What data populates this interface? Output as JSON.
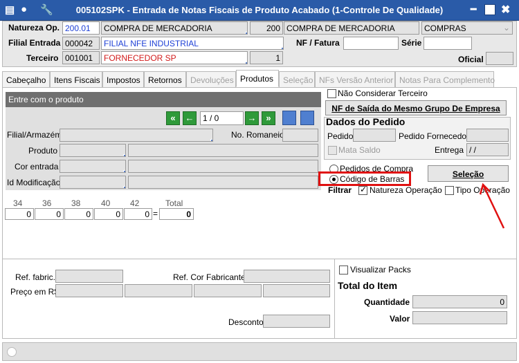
{
  "window": {
    "title": "005102SPK - Entrada de Notas Fiscais de Produto Acabado (1-Controle De Qualidade)"
  },
  "header": {
    "natureza_label": "Natureza Op.",
    "natureza_code": "200.01",
    "natureza_desc": "COMPRA DE MERCADORIA",
    "natureza_num": "200",
    "natureza_desc2": "COMPRA DE MERCADORIA",
    "natureza_type": "COMPRAS",
    "filial_label": "Filial Entrada",
    "filial_code": "000042",
    "filial_desc": "FILIAL NFE INDUSTRIAL",
    "terceiro_label": "Terceiro",
    "terceiro_code": "001001",
    "terceiro_desc": "FORNECEDOR SP",
    "terceiro_num": "1",
    "nf_fatura_label": "NF / Fatura",
    "serie_label": "Série",
    "oficial_label": "Oficial"
  },
  "tabs": [
    {
      "label": "Cabeçalho",
      "state": "normal"
    },
    {
      "label": "Itens Fiscais",
      "state": "normal"
    },
    {
      "label": "Impostos",
      "state": "normal"
    },
    {
      "label": "Retornos",
      "state": "normal"
    },
    {
      "label": "Devoluções",
      "state": "disabled"
    },
    {
      "label": "Produtos",
      "state": "active"
    },
    {
      "label": "Seleção",
      "state": "disabled"
    },
    {
      "label": "NFs Versão Anterior",
      "state": "disabled"
    },
    {
      "label": "Notas Para Complemento",
      "state": "disabled"
    }
  ],
  "produto_panel": {
    "title": "Entre com o produto",
    "counter": "1 / 0",
    "filial_label": "Filial/Armazém",
    "romaneio_label": "No. Romaneio",
    "produto_label": "Produto",
    "cor_label": "Cor entrada",
    "id_mod_label": "Id Modificação"
  },
  "right_panel": {
    "nao_considerar_label": "Não Considerar Terceiro",
    "nf_saida_button": "NF de Saída do Mesmo Grupo De Empresa",
    "dados_title": "Dados do Pedido",
    "pedido_label": "Pedido",
    "pedido_fornecedor_label": "Pedido Fornecedor",
    "mata_saldo_label": "Mata Saldo",
    "entrega_label": "Entrega",
    "entrega_value": " / /",
    "radio_pedidos": "Pedidos de Compra",
    "radio_codigo": "Código de Barras",
    "selecao_button": "Seleção",
    "filtrar_label": "Filtrar",
    "natureza_check": "Natureza Operação",
    "tipo_check": "Tipo Operação"
  },
  "size_grid": {
    "headers": [
      "34",
      "36",
      "38",
      "40",
      "42",
      "Total"
    ],
    "values": [
      "0",
      "0",
      "0",
      "0",
      "0"
    ],
    "equals": "=",
    "total": "0"
  },
  "bottom": {
    "ref_fabric_label": "Ref. fabric.",
    "ref_cor_label": "Ref. Cor Fabricante",
    "preco_label": "Preço em R$",
    "desconto_label": "Desconto",
    "visualizar_packs": "Visualizar Packs",
    "total_item_title": "Total do Item",
    "quantidade_label": "Quantidade",
    "quantidade_value": "0",
    "valor_label": "Valor"
  },
  "colors": {
    "titlebar": "#2a5ba8",
    "highlight": "#e01010",
    "nav_green": "#2f9a3a"
  }
}
